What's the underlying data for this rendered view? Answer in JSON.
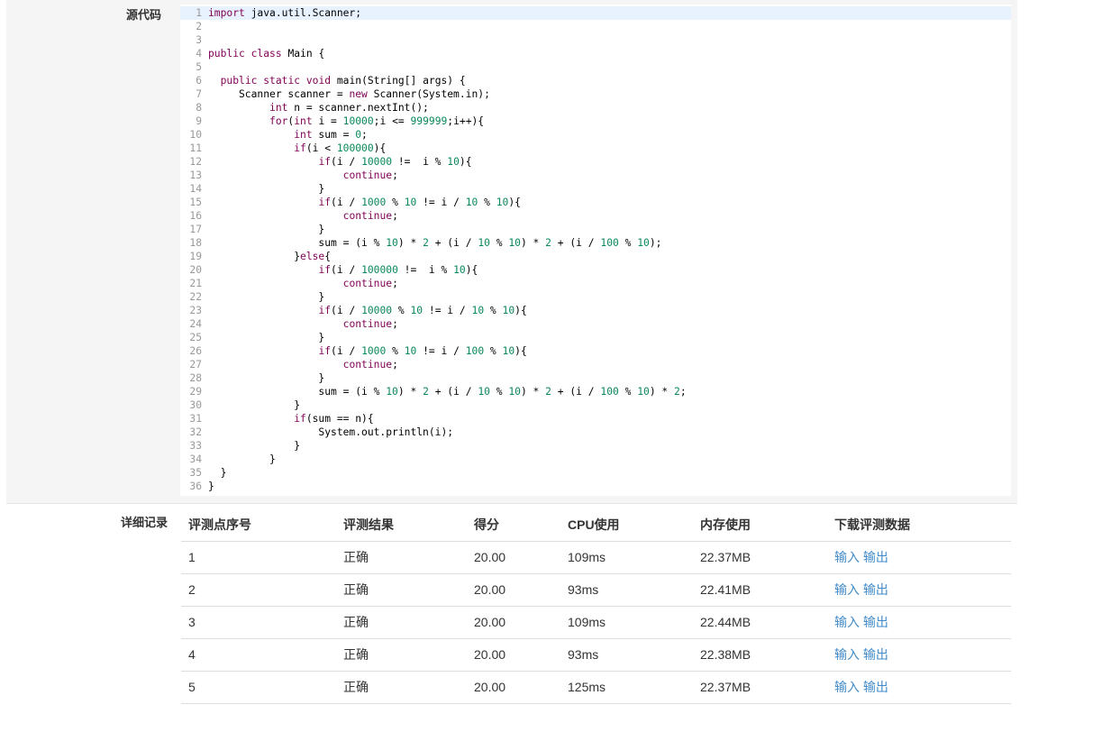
{
  "source": {
    "label": "源代码",
    "lines": [
      {
        "n": "1",
        "t": "import java.util.Scanner;"
      },
      {
        "n": "2",
        "t": ""
      },
      {
        "n": "3",
        "t": ""
      },
      {
        "n": "4",
        "t": "public class Main {"
      },
      {
        "n": "5",
        "t": ""
      },
      {
        "n": "6",
        "t": "  public static void main(String[] args) {"
      },
      {
        "n": "7",
        "t": "     Scanner scanner = new Scanner(System.in);"
      },
      {
        "n": "8",
        "t": "          int n = scanner.nextInt();"
      },
      {
        "n": "9",
        "t": "          for(int i = 10000;i <= 999999;i++){"
      },
      {
        "n": "10",
        "t": "              int sum = 0;"
      },
      {
        "n": "11",
        "t": "              if(i < 100000){"
      },
      {
        "n": "12",
        "t": "                  if(i / 10000 !=  i % 10){"
      },
      {
        "n": "13",
        "t": "                      continue;"
      },
      {
        "n": "14",
        "t": "                  }"
      },
      {
        "n": "15",
        "t": "                  if(i / 1000 % 10 != i / 10 % 10){"
      },
      {
        "n": "16",
        "t": "                      continue;"
      },
      {
        "n": "17",
        "t": "                  }"
      },
      {
        "n": "18",
        "t": "                  sum = (i % 10) * 2 + (i / 10 % 10) * 2 + (i / 100 % 10);"
      },
      {
        "n": "19",
        "t": "              }else{"
      },
      {
        "n": "20",
        "t": "                  if(i / 100000 !=  i % 10){"
      },
      {
        "n": "21",
        "t": "                      continue;"
      },
      {
        "n": "22",
        "t": "                  }"
      },
      {
        "n": "23",
        "t": "                  if(i / 10000 % 10 != i / 10 % 10){"
      },
      {
        "n": "24",
        "t": "                      continue;"
      },
      {
        "n": "25",
        "t": "                  }"
      },
      {
        "n": "26",
        "t": "                  if(i / 1000 % 10 != i / 100 % 10){"
      },
      {
        "n": "27",
        "t": "                      continue;"
      },
      {
        "n": "28",
        "t": "                  }"
      },
      {
        "n": "29",
        "t": "                  sum = (i % 10) * 2 + (i / 10 % 10) * 2 + (i / 100 % 10) * 2;"
      },
      {
        "n": "30",
        "t": "              }"
      },
      {
        "n": "31",
        "t": "              if(sum == n){"
      },
      {
        "n": "32",
        "t": "                  System.out.println(i);"
      },
      {
        "n": "33",
        "t": "              }"
      },
      {
        "n": "34",
        "t": "          }"
      },
      {
        "n": "35",
        "t": "  }"
      },
      {
        "n": "36",
        "t": "}"
      }
    ]
  },
  "records": {
    "label": "详细记录",
    "headers": [
      "评测点序号",
      "评测结果",
      "得分",
      "CPU使用",
      "内存使用",
      "下载评测数据"
    ],
    "rows": [
      {
        "id": "1",
        "result": "正确",
        "score": "20.00",
        "cpu": "109ms",
        "mem": "22.37MB",
        "in": "输入",
        "out": "输出"
      },
      {
        "id": "2",
        "result": "正确",
        "score": "20.00",
        "cpu": "93ms",
        "mem": "22.41MB",
        "in": "输入",
        "out": "输出"
      },
      {
        "id": "3",
        "result": "正确",
        "score": "20.00",
        "cpu": "109ms",
        "mem": "22.44MB",
        "in": "输入",
        "out": "输出"
      },
      {
        "id": "4",
        "result": "正确",
        "score": "20.00",
        "cpu": "93ms",
        "mem": "22.38MB",
        "in": "输入",
        "out": "输出"
      },
      {
        "id": "5",
        "result": "正确",
        "score": "20.00",
        "cpu": "125ms",
        "mem": "22.37MB",
        "in": "输入",
        "out": "输出"
      }
    ]
  },
  "colors": {
    "keyword": "#7f0055",
    "number": "#09885a",
    "link": "#428bca",
    "active_line": "#e8f2ff"
  }
}
